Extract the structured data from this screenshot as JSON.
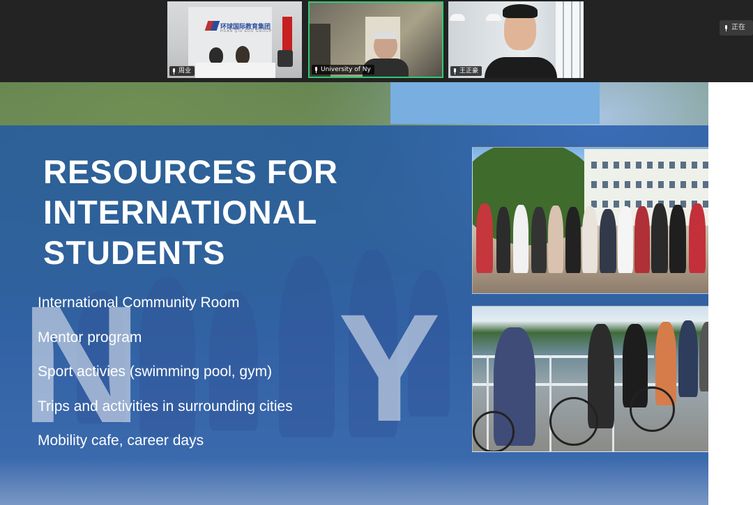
{
  "meeting": {
    "participants": [
      {
        "name": "周业",
        "active_speaker": false
      },
      {
        "name": "University of Ny",
        "active_speaker": true
      },
      {
        "name": "王正豪",
        "active_speaker": false
      }
    ],
    "status_label": "正在",
    "tile1_brand": "环球国际教育集团",
    "tile1_brand_sub": "HUAN QIU EDU GROUP"
  },
  "slide": {
    "title_lines": [
      "RESOURCES FOR",
      "INTERNATIONAL",
      "STUDENTS"
    ],
    "resources": [
      "International Community Room",
      "Mentor program",
      "Sport activies (swimming pool, gym)",
      "Trips and activities in surrounding cities",
      "Mobility cafe, career days"
    ],
    "background_letters": [
      "N",
      "Y"
    ]
  },
  "colors": {
    "overlay_blue": "#1b54aa",
    "active_speaker_border": "#2ecc71",
    "text_white": "#ffffff"
  }
}
